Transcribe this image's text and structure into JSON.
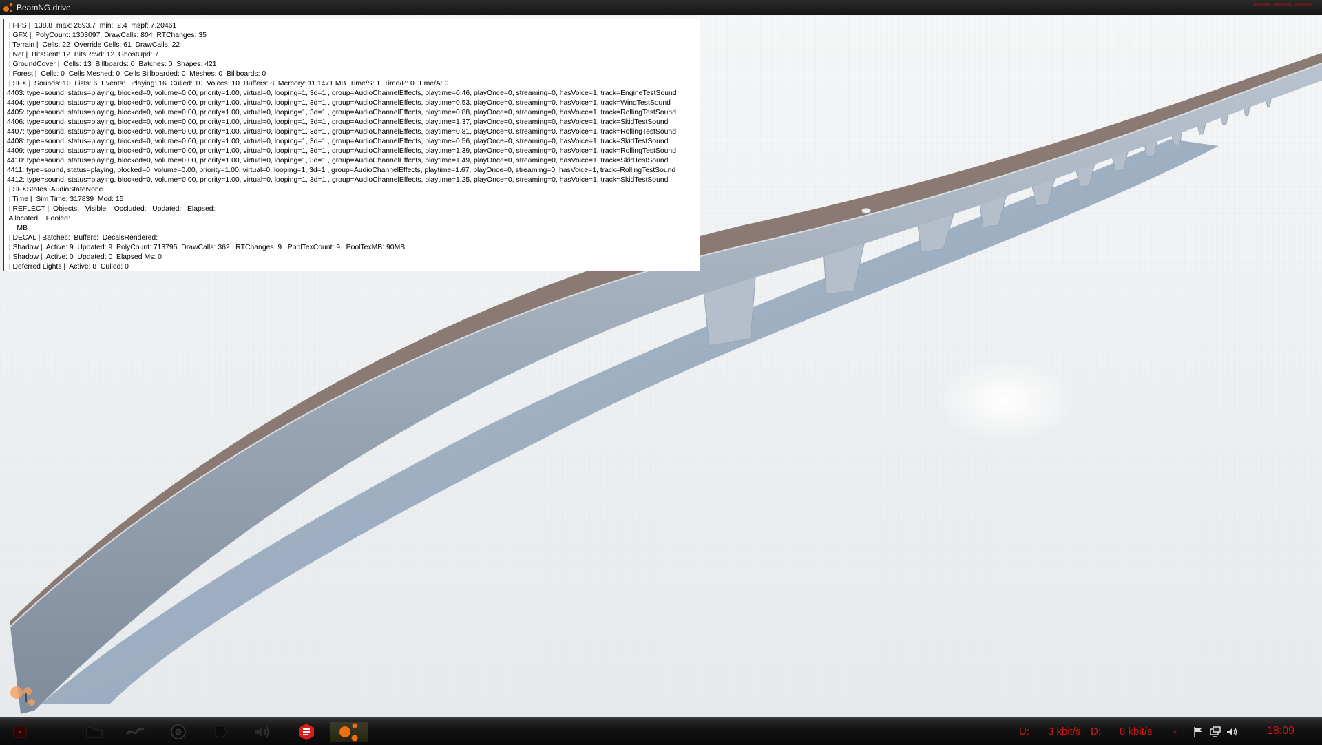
{
  "window": {
    "title": "BeamNG.drive",
    "logo_icon": "beamng-logo-icon"
  },
  "debug_lines": [
    " | FPS |  138.8  max: 2693.7  min:  2.4  mspf: 7.20461",
    " | GFX |  PolyCount: 1303097  DrawCalls: 804  RTChanges: 35",
    " | Terrain |  Cells: 22  Override Cells: 61  DrawCalls: 22",
    " | Net |  BitsSent: 12  BitsRcvd: 12  GhostUpd: 7",
    " | GroundCover |  Cells: 13  Billboards: 0  Batches: 0  Shapes: 421",
    " | Forest |  Cells: 0  Cells Meshed: 0  Cells Billboarded: 0  Meshes: 0  Billboards: 0",
    " | SFX |  Sounds: 10  Lists: 6  Events:   Playing: 16  Culled: 10  Voices: 10  Buffers: 8  Memory: 11.1471 MB  Time/S: 1  Time/P: 0  Time/A: 0",
    "4403: type=sound, status=playing, blocked=0, volume=0.00, priority=1.00, virtual=0, looping=1, 3d=1 , group=AudioChannelEffects, playtime=0.46, playOnce=0, streaming=0, hasVoice=1, track=EngineTestSound",
    "4404: type=sound, status=playing, blocked=0, volume=0.00, priority=1.00, virtual=0, looping=1, 3d=1 , group=AudioChannelEffects, playtime=0.53, playOnce=0, streaming=0, hasVoice=1, track=WindTestSound",
    "4405: type=sound, status=playing, blocked=0, volume=0.00, priority=1.00, virtual=0, looping=1, 3d=1 , group=AudioChannelEffects, playtime=0.88, playOnce=0, streaming=0, hasVoice=1, track=RollingTestSound",
    "4406: type=sound, status=playing, blocked=0, volume=0.00, priority=1.00, virtual=0, looping=1, 3d=1 , group=AudioChannelEffects, playtime=1.37, playOnce=0, streaming=0, hasVoice=1, track=SkidTestSound",
    "4407: type=sound, status=playing, blocked=0, volume=0.00, priority=1.00, virtual=0, looping=1, 3d=1 , group=AudioChannelEffects, playtime=0.81, playOnce=0, streaming=0, hasVoice=1, track=RollingTestSound",
    "4408: type=sound, status=playing, blocked=0, volume=0.00, priority=1.00, virtual=0, looping=1, 3d=1 , group=AudioChannelEffects, playtime=0.56, playOnce=0, streaming=0, hasVoice=1, track=SkidTestSound",
    "4409: type=sound, status=playing, blocked=0, volume=0.00, priority=1.00, virtual=0, looping=1, 3d=1 , group=AudioChannelEffects, playtime=1.39, playOnce=0, streaming=0, hasVoice=1, track=RollingTestSound",
    "4410: type=sound, status=playing, blocked=0, volume=0.00, priority=1.00, virtual=0, looping=1, 3d=1 , group=AudioChannelEffects, playtime=1.49, playOnce=0, streaming=0, hasVoice=1, track=SkidTestSound",
    "4411: type=sound, status=playing, blocked=0, volume=0.00, priority=1.00, virtual=0, looping=1, 3d=1 , group=AudioChannelEffects, playtime=1.67, playOnce=0, streaming=0, hasVoice=1, track=RollingTestSound",
    "4412: type=sound, status=playing, blocked=0, volume=0.00, priority=1.00, virtual=0, looping=1, 3d=1 , group=AudioChannelEffects, playtime=1.25, playOnce=0, streaming=0, hasVoice=1, track=SkidTestSound",
    " | SFXStates |AudioStateNone",
    " | Time |  Sim Time: 317839  Mod: 15",
    " | REFLECT |  Objects:   Visible:   Occluded:   Updated:   Elapsed:",
    " Allocated:   Pooled:",
    "     MB",
    " | DECAL | Batches:  Buffers:  DecalsRendered:",
    " | Shadow |  Active: 9  Updated: 9  PolyCount: 713795  DrawCalls: 362   RTChanges: 9   PoolTexCount: 9   PoolTexMB: 90MB",
    " | Shadow |  Active: 0  Updated: 0  Elapsed Ms: 0",
    " | Deferred Lights |  Active: 8  Culled: 0"
  ],
  "taskbar": {
    "items": [
      {
        "icon": "media-player-icon",
        "active": false
      },
      {
        "icon": "folder-icon",
        "active": false
      },
      {
        "icon": "network-tool-icon",
        "active": false
      },
      {
        "icon": "chrome-icon",
        "active": false
      },
      {
        "icon": "app-icon",
        "active": false
      },
      {
        "icon": "volume-app-icon",
        "active": false
      },
      {
        "icon": "sketchup-icon",
        "active": false
      },
      {
        "icon": "beamng-icon",
        "active": true
      }
    ],
    "upload_label": "U:",
    "upload_value": "3 kbit/s",
    "download_label": "D:",
    "download_value": "8 kbit/s",
    "separator": "-",
    "clock": "18:09",
    "tray_icons": [
      "flag-icon",
      "network-icon",
      "speaker-icon"
    ],
    "tray_color": "#d01818"
  }
}
